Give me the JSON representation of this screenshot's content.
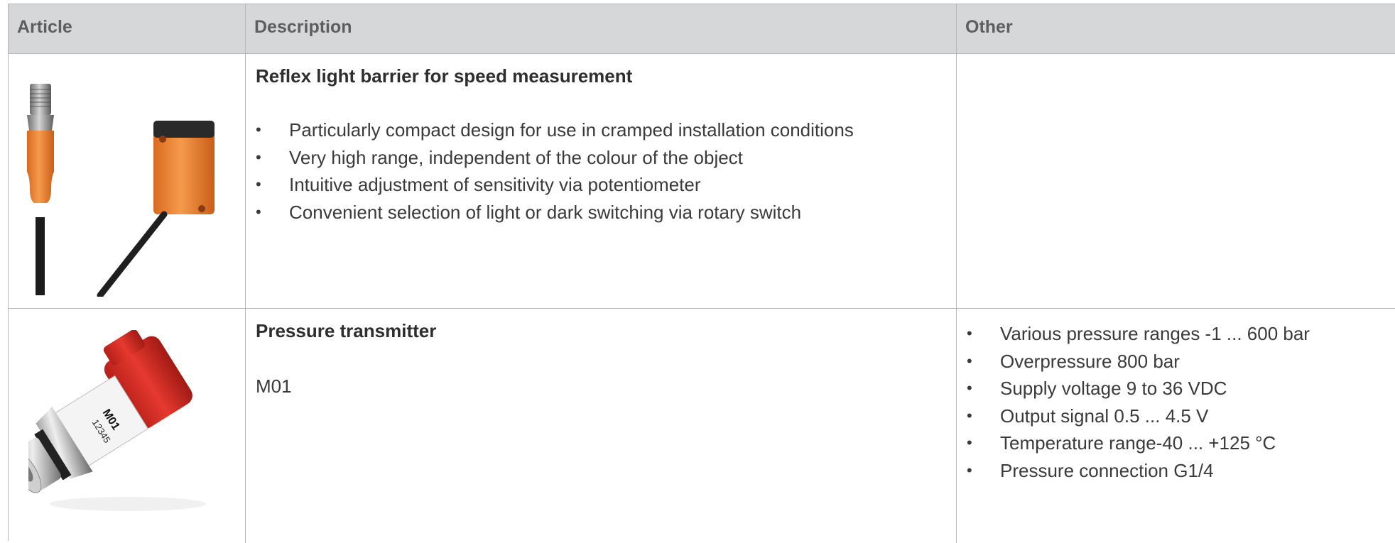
{
  "header": {
    "article": "Article",
    "description": "Description",
    "other": "Other"
  },
  "rows": [
    {
      "title": "Reflex light barrier for speed measurement",
      "bullets": [
        "Particularly compact design for use in cramped installation conditions",
        "Very high range, independent of the colour of the object",
        "Intuitive adjustment of sensitivity via potentiometer",
        "Convenient selection of light or dark switching via rotary switch"
      ],
      "other": []
    },
    {
      "title": "Pressure transmitter",
      "subtitle": "M01",
      "other": [
        "Various pressure ranges -1 ... 600 bar",
        "Overpressure 800 bar",
        "Supply voltage 9 to 36 VDC",
        "Output signal 0.5 ... 4.5 V",
        "Temperature range-40 ... +125 °C",
        "Pressure connection G1/4"
      ],
      "sensor_label_1": "12345",
      "sensor_label_2": "M01"
    }
  ],
  "colors": {
    "header_bg": "#d6d7d9",
    "sensor_orange": "#f0893a",
    "transmitter_red": "#d62e25"
  }
}
